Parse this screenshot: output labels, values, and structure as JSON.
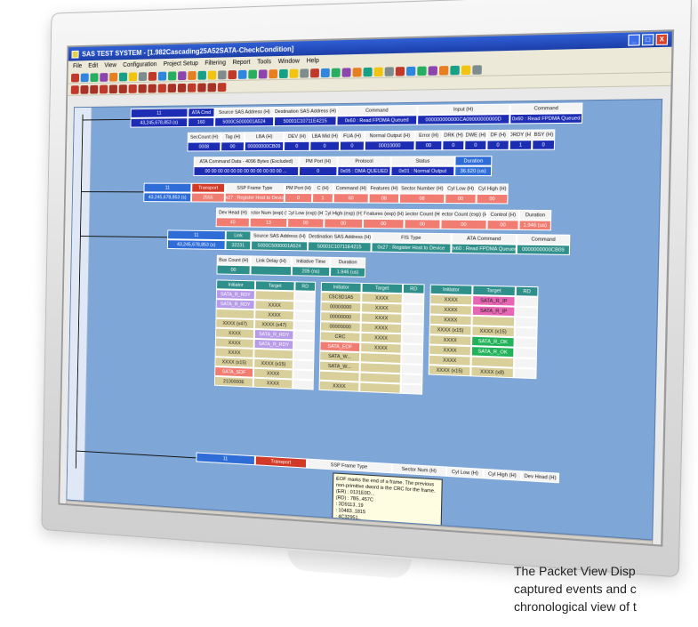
{
  "window": {
    "title": "SAS TEST SYSTEM - [1.982Cascading25A52SATA-CheckCondition]",
    "min_label": "_",
    "max_label": "□",
    "close_label": "X"
  },
  "menu": [
    "File",
    "Edit",
    "View",
    "Configuration",
    "Project Setup",
    "Filtering",
    "Report",
    "Tools",
    "Window",
    "Help"
  ],
  "colors": {
    "titlebar": "#1c3ea8",
    "view_bg": "#7ea6d6",
    "header_cell": "#f4f4f4",
    "dark_blue": "#1c2db4",
    "salmon": "#f07c72",
    "teal": "#2f8f8a"
  },
  "packets": {
    "row1_head": [
      "11",
      "ATA Cmd",
      "Source SAS Address (H)",
      "Destination SAS Address (H)",
      "Command",
      "Input (H)",
      "Command"
    ],
    "row1_vals": [
      "43,245,678,853 (s)",
      "160",
      "5000C5000001A524",
      "50001C10711E4215",
      "0x60 : Read FPDMA Queued",
      "000000000000CA09000000000D",
      "0x60 : Read FPDMA Queued"
    ],
    "row2_head": [
      "SecCount (H)",
      "Tag (H)",
      "LBA (H)",
      "DEV (H)",
      "LBA Mid (H)",
      "FUA (H)",
      "Normal Output (H)",
      "Error (H)",
      "DRK (H)",
      "DWE (H)",
      "DF (H)",
      "DRDY (H)",
      "BSY (H)"
    ],
    "row2_vals": [
      "0008",
      "00",
      "00000000CB09",
      "0",
      "0",
      "0",
      "00010000",
      "00",
      "0",
      "0",
      "0",
      "1",
      "0"
    ],
    "row3_head": [
      "ATA Command Data - 4096 Bytes (Excluded)",
      "PM Port (H)",
      "Protocol",
      "Status",
      "Duration"
    ],
    "row3_vals": [
      "00 00 00 00 00 00 00 00 00 00 00 00 ...",
      "0",
      "0x05 : DMA QUEUED",
      "0x01 : Normal Output",
      "36.620 (us)"
    ],
    "row4_head": [
      "11",
      "Transport",
      "SSP Frame Type",
      "PM Port (H)",
      "C (H)",
      "Command (H)",
      "Features (H)",
      "Sector Number (H)",
      "Cyl Low (H)",
      "Cyl High (H)"
    ],
    "row4_vals": [
      "43,245,678,853 (s)",
      "2555",
      "0x27 : Register Host to Device",
      "0",
      "1",
      "60",
      "08",
      "08",
      "00",
      "00"
    ],
    "row5_head": [
      "Dev Head (H)",
      "Sector Num (exp) (H)",
      "Cyl Low (exp) (H)",
      "Cyl High (exp) (H)",
      "Features (exp) (H)",
      "Sector Count (H)",
      "Sector Count (exp) (H)",
      "Control (H)",
      "Duration"
    ],
    "row5_vals": [
      "40",
      "13",
      "00",
      "00",
      "00",
      "00",
      "00",
      "00",
      "1.946 (us)"
    ],
    "row6_head": [
      "11",
      "Link",
      "Source SAS Address (H)",
      "Destination SAS Address (H)",
      "FIS Type",
      "ATA Command",
      "Command"
    ],
    "row6_vals": [
      "43,245,678,853 (s)",
      "32231",
      "5000C5000001A524",
      "50001C10711E4215",
      "0x27 : Register Host to Device",
      "0x60 : Read FPDMA Queued",
      "0000000000CB09"
    ],
    "row7_head": [
      "Bus Count (H)",
      "Link Delay (H)",
      "Initiative Time",
      "Duration"
    ],
    "row7_vals": [
      "00",
      "",
      "205 (ns)",
      "1.946 (us)"
    ],
    "tables": [
      {
        "head": [
          "Initiator",
          "Target",
          "RD"
        ],
        "rows": [
          [
            "SATA_R_RDY",
            "",
            ""
          ],
          [
            "SATA_R_RDY",
            "XXXX",
            ""
          ],
          [
            "",
            "XXXX",
            ""
          ],
          [
            "XXXX (x47)",
            "XXXX (x47)",
            ""
          ],
          [
            "XXXX",
            "SATA_R_RDY",
            ""
          ],
          [
            "XXXX",
            "SATA_R_RDY",
            ""
          ],
          [
            "XXXX",
            "",
            ""
          ],
          [
            "XXXX (x15)",
            "XXXX (x15)",
            ""
          ],
          [
            "SATA_SOF",
            "XXXX",
            ""
          ],
          [
            "2100000E",
            "XXXX",
            ""
          ]
        ]
      },
      {
        "head": [
          "Initiator",
          "Target",
          "RD"
        ],
        "rows": [
          [
            "C5C9D1A5",
            "XXXX",
            ""
          ],
          [
            "00000000",
            "XXXX",
            ""
          ],
          [
            "00000000",
            "XXXX",
            ""
          ],
          [
            "00000000",
            "XXXX",
            ""
          ],
          [
            "CRC",
            "XXXX",
            ""
          ],
          [
            "SATA_EOF",
            "XXXX",
            ""
          ],
          [
            "SATA_W...",
            "",
            ""
          ],
          [
            "SATA_W...",
            "",
            ""
          ],
          [
            "",
            "",
            ""
          ],
          [
            "XXXX",
            "",
            ""
          ]
        ]
      },
      {
        "head": [
          "Initiator",
          "Target",
          "RD"
        ],
        "rows": [
          [
            "XXXX",
            "SATA_R_IP",
            ""
          ],
          [
            "XXXX",
            "SATA_R_IP",
            ""
          ],
          [
            "XXXX",
            "",
            ""
          ],
          [
            "XXXX (x15)",
            "XXXX (x15)",
            ""
          ],
          [
            "XXXX",
            "SATA_R_OK",
            ""
          ],
          [
            "XXXX",
            "SATA_R_OK",
            ""
          ],
          [
            "XXXX",
            "",
            ""
          ],
          [
            "XXXX (x15)",
            "XXXX (x8)",
            ""
          ]
        ]
      }
    ],
    "row8_head": [
      "11",
      "Transport",
      "SSP Frame Type",
      "Sector Num (H)",
      "Cyl Low (H)",
      "Cyl High (H)",
      "Dev Head (H)"
    ],
    "row8_vals": []
  },
  "tooltip": {
    "line1": "EOF marks the end of a frame. The previous",
    "line2": "non-primitive dword is the CRC for the frame.",
    "lines": [
      "(ER) : 0131E0D...",
      "(RD) : 7B5..457C",
      "    : 3D9113..19",
      "    : 10483..1815",
      "    : 4C32951..",
      "    : 4C0901..."
    ]
  },
  "caption": {
    "line1": "The Packet View Disp",
    "line2": "captured events and c",
    "line3": "chronological view of t"
  }
}
